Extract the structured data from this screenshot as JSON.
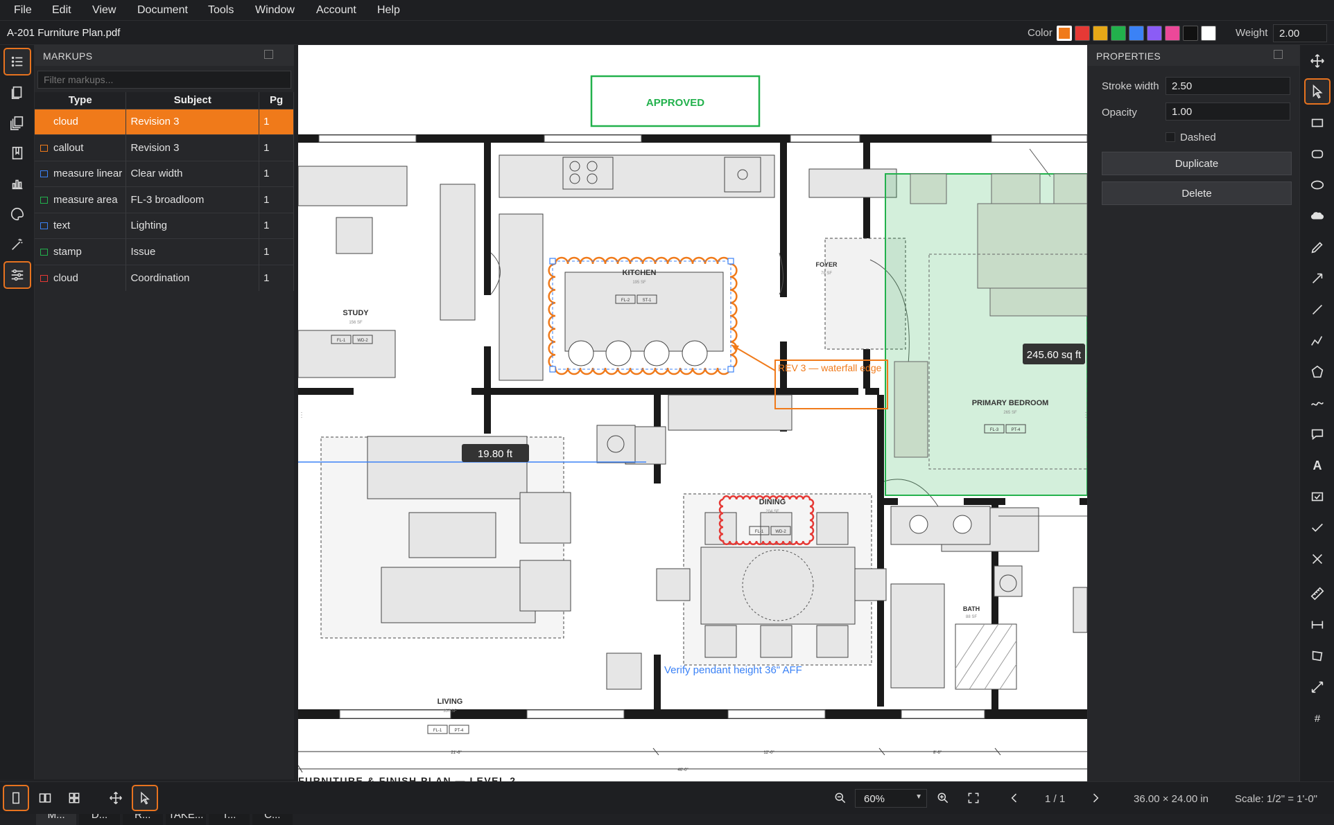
{
  "menu": [
    "File",
    "Edit",
    "View",
    "Document",
    "Tools",
    "Window",
    "Account",
    "Help"
  ],
  "document": {
    "title": "A-201 Furniture Plan.pdf"
  },
  "toolbar": {
    "color_label": "Color",
    "colors": [
      "#f07a1a",
      "#e53935",
      "#e6a817",
      "#22b14c",
      "#3b82f6",
      "#8b5cf6",
      "#ec4899",
      "#111111",
      "#ffffff"
    ],
    "weight_label": "Weight",
    "weight_value": "2.00"
  },
  "markups_panel": {
    "title": "MARKUPS",
    "filter_placeholder": "Filter markups...",
    "columns": [
      "Type",
      "Subject",
      "Pg"
    ],
    "rows": [
      {
        "type": "cloud",
        "subject": "Revision 3",
        "pg": "1",
        "color": "#f07a1a",
        "selected": true
      },
      {
        "type": "callout",
        "subject": "Revision 3",
        "pg": "1",
        "color": "#f07a1a"
      },
      {
        "type": "measure linear",
        "subject": "Clear width",
        "pg": "1",
        "color": "#3b82f6"
      },
      {
        "type": "measure area",
        "subject": "FL-3 broadloom",
        "pg": "1",
        "color": "#22b14c"
      },
      {
        "type": "text",
        "subject": "Lighting",
        "pg": "1",
        "color": "#3b82f6"
      },
      {
        "type": "stamp",
        "subject": "Issue",
        "pg": "1",
        "color": "#22b14c"
      },
      {
        "type": "cloud",
        "subject": "Coordination",
        "pg": "1",
        "color": "#e53935"
      }
    ],
    "tabs": [
      "M...",
      "D...",
      "R...",
      "TAKE...",
      "T...",
      "C..."
    ]
  },
  "plan": {
    "stamp": "APPROVED",
    "rooms": [
      {
        "name": "STUDY",
        "area": "156 SF",
        "tags": [
          "FL-1",
          "WD-2"
        ]
      },
      {
        "name": "KITCHEN",
        "area": "195 SF",
        "tags": [
          "FL-2",
          "ST-1"
        ]
      },
      {
        "name": "FOYER",
        "area": "78 SF",
        "tags": []
      },
      {
        "name": "PRIMARY BEDROOM",
        "area": "265 SF",
        "tags": [
          "FL-3",
          "PT-4"
        ]
      },
      {
        "name": "DINING",
        "area": "204 SF",
        "tags": [
          "FL-1",
          "WD-2"
        ]
      },
      {
        "name": "LIVING",
        "area": "357 SF",
        "tags": [
          "FL-1",
          "PT-4"
        ]
      },
      {
        "name": "BATH",
        "area": "88 SF",
        "tags": []
      }
    ],
    "callout_text": "REV 3 — waterfall edge",
    "linear_measure": "19.80 ft",
    "area_measure": "245.60 sq ft",
    "note_text": "Verify pendant height 36\" AFF",
    "dims": [
      "21'-6\"",
      "12'-0\"",
      "8'-6\"",
      "46'-0\""
    ],
    "sheet_title": "FURNITURE & FINISH PLAN — LEVEL 2"
  },
  "properties": {
    "title": "PROPERTIES",
    "stroke_width_label": "Stroke width",
    "stroke_width": "2.50",
    "opacity_label": "Opacity",
    "opacity": "1.00",
    "dashed_label": "Dashed",
    "duplicate": "Duplicate",
    "delete": "Delete"
  },
  "status": {
    "zoom": "60%",
    "page": "1 / 1",
    "sheet_size": "36.00 × 24.00 in",
    "scale": "Scale: 1/2\" = 1'-0\""
  }
}
